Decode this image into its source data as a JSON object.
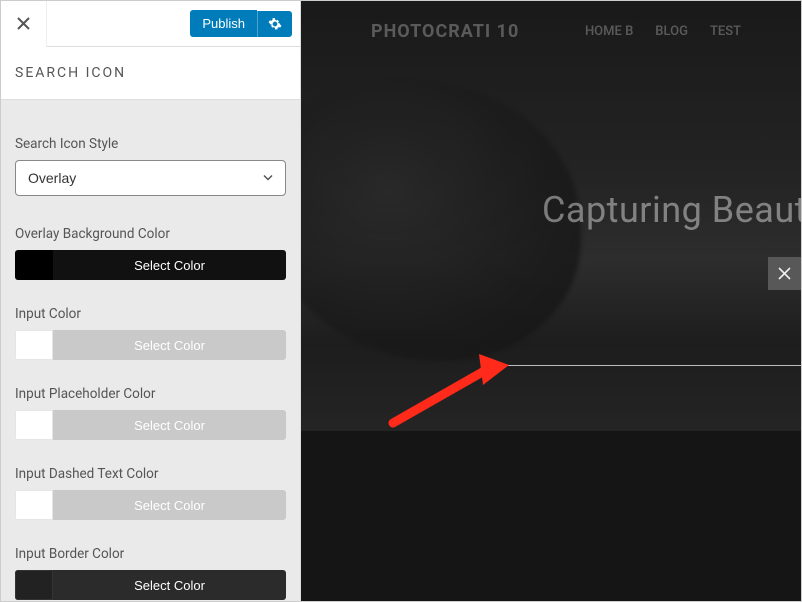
{
  "header": {
    "publish_label": "Publish"
  },
  "section": {
    "title": "SEARCH ICON"
  },
  "fields": {
    "style": {
      "label": "Search Icon Style",
      "value": "Overlay"
    },
    "overlay_bg": {
      "label": "Overlay Background Color",
      "button": "Select Color",
      "swatch": "#000000"
    },
    "input_color": {
      "label": "Input Color",
      "button": "Select Color",
      "swatch": "#ffffff"
    },
    "placeholder_color": {
      "label": "Input Placeholder Color",
      "button": "Select Color",
      "swatch": "#ffffff"
    },
    "dashed_text_color": {
      "label": "Input Dashed Text Color",
      "button": "Select Color",
      "swatch": "#ffffff"
    },
    "border_color": {
      "label": "Input Border Color",
      "button": "Select Color",
      "swatch": "#222222"
    }
  },
  "preview": {
    "brand": "PHOTOCRATI 10",
    "nav": [
      "HOME B",
      "BLOG",
      "TEST"
    ],
    "hero": "Capturing Beaut"
  }
}
